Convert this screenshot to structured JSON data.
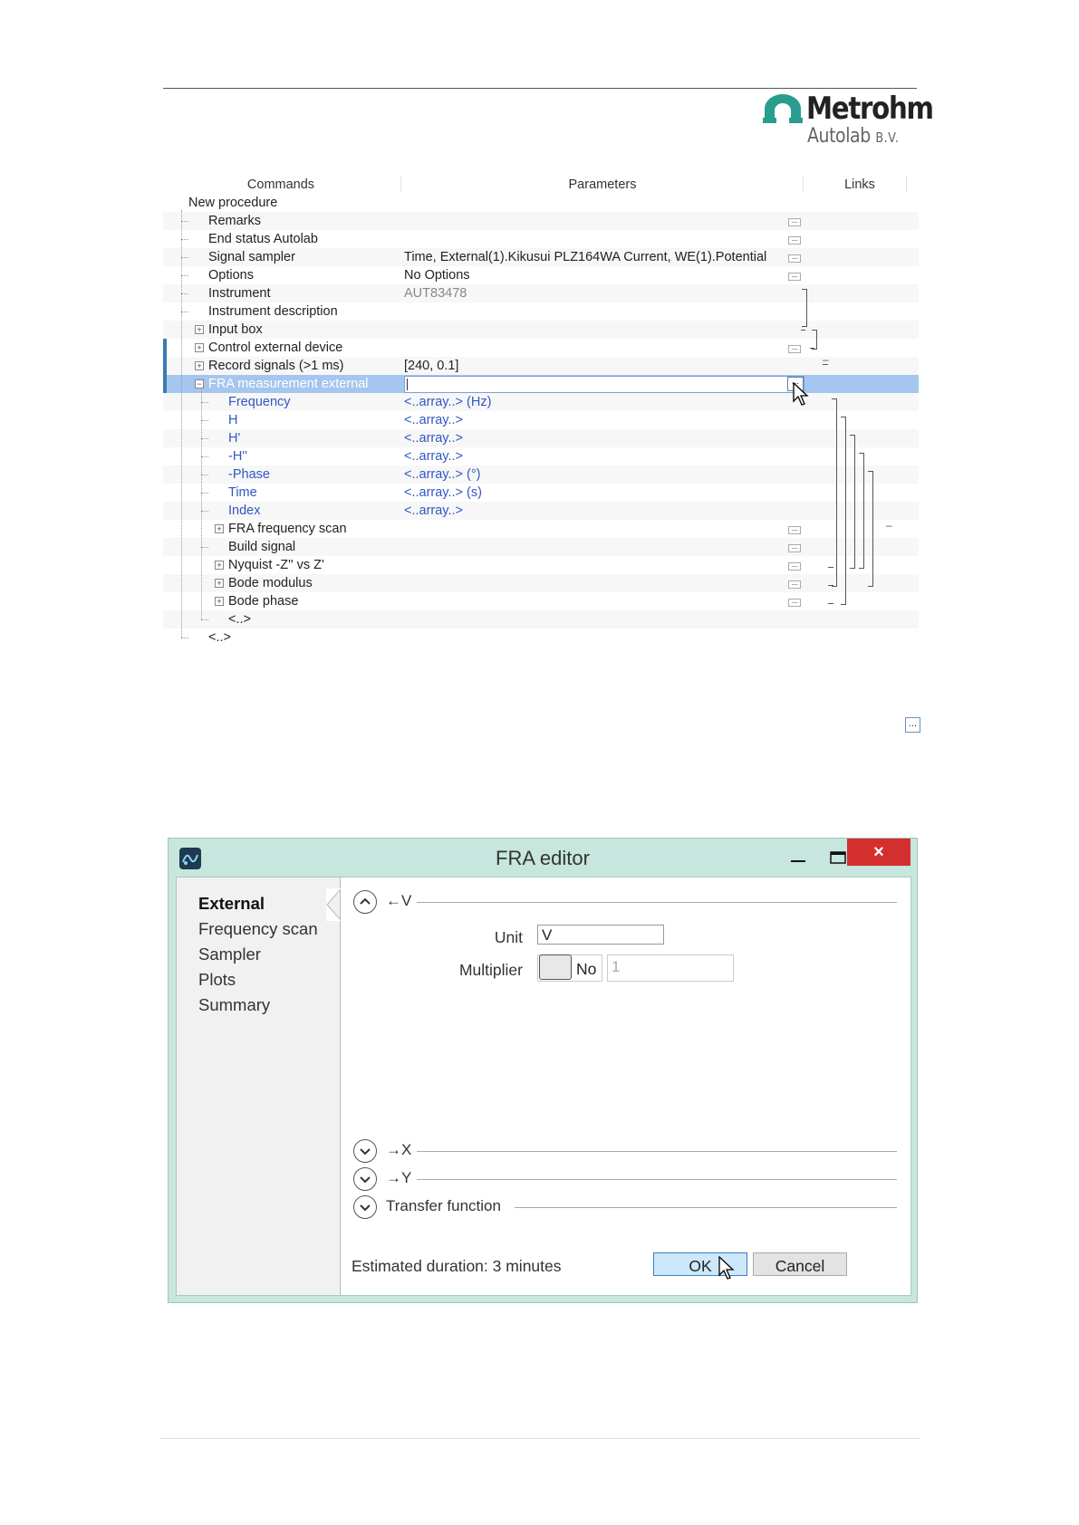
{
  "logo": {
    "name": "Metrohm",
    "sub": "Autolab",
    "sub_suffix": "B.V."
  },
  "tree": {
    "headers": {
      "commands": "Commands",
      "parameters": "Parameters",
      "links": "Links"
    },
    "rows": [
      {
        "label": "New procedure",
        "indent": 0
      },
      {
        "label": "Remarks",
        "indent": 1,
        "dots": "....."
      },
      {
        "label": "End status Autolab",
        "indent": 1,
        "dots": "....."
      },
      {
        "label": "Signal sampler",
        "indent": 1,
        "param": "Time, External(1).Kikusui PLZ164WA Current, WE(1).Potential",
        "dots": "....."
      },
      {
        "label": "Options",
        "indent": 1,
        "param": "No Options",
        "dots": "....."
      },
      {
        "label": "Instrument",
        "indent": 1,
        "param": "AUT83478"
      },
      {
        "label": "Instrument description",
        "indent": 1
      },
      {
        "label": "Input box",
        "indent": 1,
        "expander": "+"
      },
      {
        "label": "Control external device",
        "indent": 1,
        "expander": "+",
        "dots": "....."
      },
      {
        "label": "Record signals (>1 ms)",
        "indent": 1,
        "expander": "+",
        "param": "[240, 0.1]"
      },
      {
        "label": "FRA measurement external",
        "indent": 1,
        "expander": "−",
        "dots": "..."
      },
      {
        "label": "Frequency",
        "indent": 2,
        "param": "<..array..> (Hz)"
      },
      {
        "label": "H",
        "indent": 2,
        "param": "<..array..>"
      },
      {
        "label": "H'",
        "indent": 2,
        "param": "<..array..>"
      },
      {
        "label": "-H''",
        "indent": 2,
        "param": "<..array..>"
      },
      {
        "label": "-Phase",
        "indent": 2,
        "param": "<..array..> (°)"
      },
      {
        "label": "Time",
        "indent": 2,
        "param": "<..array..> (s)"
      },
      {
        "label": "Index",
        "indent": 2,
        "param": "<..array..>"
      },
      {
        "label": "FRA frequency scan",
        "indent": 2,
        "expander": "+",
        "dots": "....."
      },
      {
        "label": "Build signal",
        "indent": 2,
        "dots": "....."
      },
      {
        "label": "Nyquist -Z'' vs Z'",
        "indent": 2,
        "expander": "+",
        "dots": "....."
      },
      {
        "label": "Bode modulus",
        "indent": 2,
        "expander": "+",
        "dots": "....."
      },
      {
        "label": "Bode phase",
        "indent": 2,
        "expander": "+",
        "dots": "....."
      },
      {
        "label": "<..>",
        "indent": 2
      },
      {
        "label": "<..>",
        "indent": 1
      }
    ],
    "minus_mark": "–"
  },
  "lone_button": "...",
  "dialog": {
    "title": "FRA editor",
    "close": "×",
    "nav": [
      "External",
      "Frequency scan",
      "Sampler",
      "Plots",
      "Summary"
    ],
    "sections": {
      "v": "←V",
      "x": "→X",
      "y": "→Y",
      "tf": "Transfer function"
    },
    "unit_label": "Unit",
    "unit_value": "V",
    "multiplier_label": "Multiplier",
    "multiplier_toggle": "No",
    "multiplier_value": "1",
    "estimated": "Estimated duration: 3 minutes",
    "ok": "OK",
    "cancel": "Cancel"
  },
  "colors": {
    "selection": "#a5c6ee",
    "blue_text": "#2f57c4",
    "dialog_frame": "#c7e6de",
    "close_red": "#d32f2f",
    "logo_teal": "#2a9d8f"
  },
  "icons": [
    "metrohm-logo-icon",
    "expand-icon",
    "collapse-icon",
    "ellipsis-icon",
    "mouse-cursor-icon",
    "app-icon",
    "minimize-icon",
    "maximize-icon",
    "close-icon",
    "chevron-up-icon",
    "chevron-down-icon"
  ]
}
